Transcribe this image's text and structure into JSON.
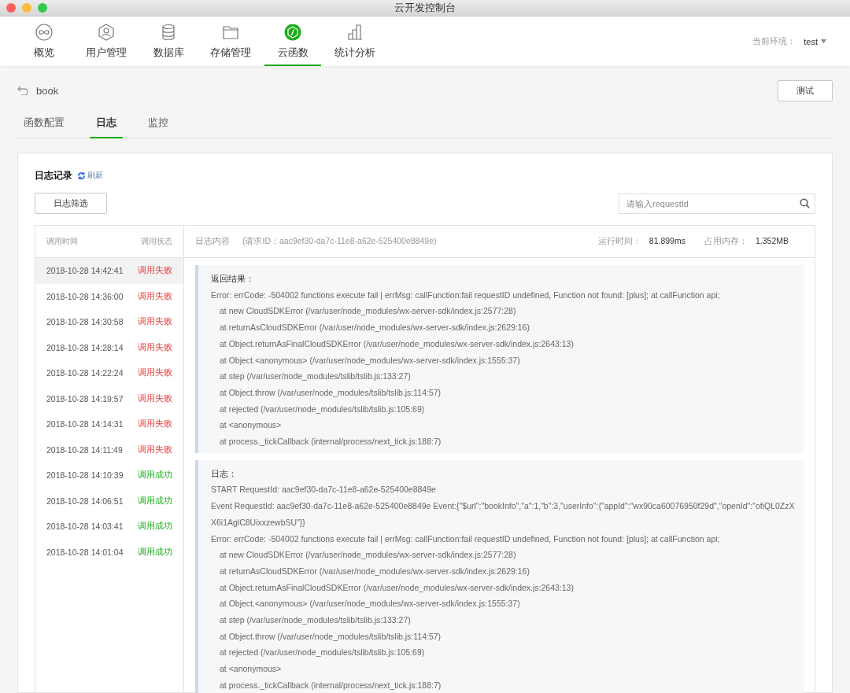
{
  "window": {
    "title": "云开发控制台"
  },
  "nav": [
    {
      "label": "概览",
      "selected": false
    },
    {
      "label": "用户管理",
      "selected": false
    },
    {
      "label": "数据库",
      "selected": false
    },
    {
      "label": "存储管理",
      "selected": false
    },
    {
      "label": "云函数",
      "selected": true
    },
    {
      "label": "统计分析",
      "selected": false
    }
  ],
  "environment": {
    "label": "当前环境：",
    "value": "test"
  },
  "function_name": "book",
  "test_button": "测试",
  "tabs": [
    {
      "label": "函数配置",
      "selected": false
    },
    {
      "label": "日志",
      "selected": true
    },
    {
      "label": "监控",
      "selected": false
    }
  ],
  "log_panel": {
    "title": "日志记录",
    "refresh": "刷新",
    "filter_button": "日志筛选",
    "search": {
      "placeholder": "请输入requestId"
    }
  },
  "list_columns": [
    "调用时间",
    "调用状态"
  ],
  "calls": [
    {
      "time": "2018-10-28 14:42:41",
      "status": "调用失败",
      "ok": false,
      "selected": true
    },
    {
      "time": "2018-10-28 14:36:00",
      "status": "调用失败",
      "ok": false,
      "selected": false
    },
    {
      "time": "2018-10-28 14:30:58",
      "status": "调用失败",
      "ok": false,
      "selected": false
    },
    {
      "time": "2018-10-28 14:28:14",
      "status": "调用失败",
      "ok": false,
      "selected": false
    },
    {
      "time": "2018-10-28 14:22:24",
      "status": "调用失败",
      "ok": false,
      "selected": false
    },
    {
      "time": "2018-10-28 14:19:57",
      "status": "调用失败",
      "ok": false,
      "selected": false
    },
    {
      "time": "2018-10-28 14:14:31",
      "status": "调用失败",
      "ok": false,
      "selected": false
    },
    {
      "time": "2018-10-28 14:11:49",
      "status": "调用失败",
      "ok": false,
      "selected": false
    },
    {
      "time": "2018-10-28 14:10:39",
      "status": "调用成功",
      "ok": true,
      "selected": false
    },
    {
      "time": "2018-10-28 14:06:51",
      "status": "调用成功",
      "ok": true,
      "selected": false
    },
    {
      "time": "2018-10-28 14:03:41",
      "status": "调用成功",
      "ok": true,
      "selected": false
    },
    {
      "time": "2018-10-28 14:01:04",
      "status": "调用成功",
      "ok": true,
      "selected": false
    }
  ],
  "detail_header": {
    "label": "日志内容",
    "request_id": "(请求ID：aac9ef30-da7c-11e8-a62e-525400e8849e)",
    "runtime_label": "运行时间：",
    "runtime": "81.899ms",
    "memory_label": "占用内存：",
    "memory": "1.352MB"
  },
  "log_blocks": [
    {
      "title": "返回结果：",
      "lines": [
        {
          "kind": "plain",
          "text": "Error: errCode: -504002 functions execute fail | errMsg: callFunction:fail requestID undefined, Function not found: [plus]; at callFunction api;"
        },
        {
          "kind": "indent",
          "text": "at new CloudSDKError (/var/user/node_modules/wx-server-sdk/index.js:2577:28)"
        },
        {
          "kind": "indent",
          "text": "at returnAsCloudSDKError (/var/user/node_modules/wx-server-sdk/index.js:2629:16)"
        },
        {
          "kind": "indent",
          "text": "at Object.returnAsFinalCloudSDKError (/var/user/node_modules/wx-server-sdk/index.js:2643:13)"
        },
        {
          "kind": "indent",
          "text": "at Object.<anonymous> (/var/user/node_modules/wx-server-sdk/index.js:1555:37)"
        },
        {
          "kind": "indent",
          "text": "at step (/var/user/node_modules/tslib/tslib.js:133:27)"
        },
        {
          "kind": "indent",
          "text": "at Object.throw (/var/user/node_modules/tslib/tslib.js:114:57)"
        },
        {
          "kind": "indent",
          "text": "at rejected (/var/user/node_modules/tslib/tslib.js:105:69)"
        },
        {
          "kind": "indent",
          "text": "at <anonymous>"
        },
        {
          "kind": "indent",
          "text": "at process._tickCallback (internal/process/next_tick.js:188:7)"
        }
      ]
    },
    {
      "title": "日志：",
      "lines": [
        {
          "kind": "plain",
          "text": "START RequestId: aac9ef30-da7c-11e8-a62e-525400e8849e"
        },
        {
          "kind": "plain",
          "text": "Event RequestId: aac9ef30-da7c-11e8-a62e-525400e8849e Event:{\"$url\":\"bookInfo\",\"a\":1,\"b\":3,\"userInfo\":{\"appId\":\"wx90ca60076950f29d\",\"openId\":\"ofiQL0ZzXX6i1AglC8UixxzewbSU\"}}"
        },
        {
          "kind": "plain",
          "text": "Error: errCode: -504002 functions execute fail | errMsg: callFunction:fail requestID undefined, Function not found: [plus]; at callFunction api;"
        },
        {
          "kind": "indent",
          "text": "at new CloudSDKError (/var/user/node_modules/wx-server-sdk/index.js:2577:28)"
        },
        {
          "kind": "indent",
          "text": "at returnAsCloudSDKError (/var/user/node_modules/wx-server-sdk/index.js:2629:16)"
        },
        {
          "kind": "indent",
          "text": "at Object.returnAsFinalCloudSDKError (/var/user/node_modules/wx-server-sdk/index.js:2643:13)"
        },
        {
          "kind": "indent",
          "text": "at Object.<anonymous> (/var/user/node_modules/wx-server-sdk/index.js:1555:37)"
        },
        {
          "kind": "indent",
          "text": "at step (/var/user/node_modules/tslib/tslib.js:133:27)"
        },
        {
          "kind": "indent",
          "text": "at Object.throw (/var/user/node_modules/tslib/tslib.js:114:57)"
        },
        {
          "kind": "indent",
          "text": "at rejected (/var/user/node_modules/tslib/tslib.js:105:69)"
        },
        {
          "kind": "indent",
          "text": "at <anonymous>"
        },
        {
          "kind": "indent",
          "text": "at process._tickCallback (internal/process/next_tick.js:188:7)"
        }
      ]
    }
  ]
}
